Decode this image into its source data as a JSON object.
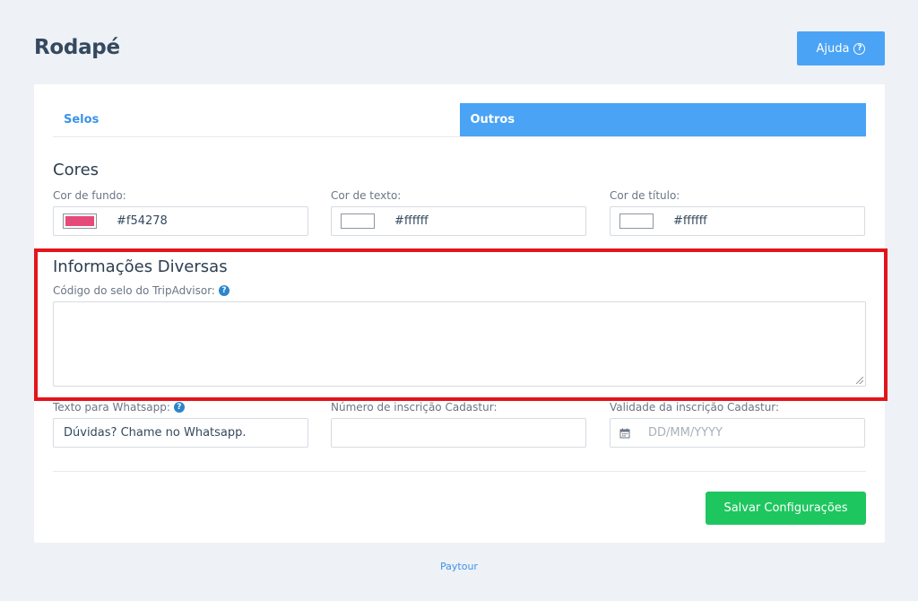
{
  "header": {
    "title": "Rodapé",
    "help_label": "Ajuda",
    "help_icon_glyph": "?"
  },
  "tabs": [
    {
      "label": "Selos",
      "active": false
    },
    {
      "label": "Outros",
      "active": true
    }
  ],
  "colors_section": {
    "title": "Cores",
    "fields": [
      {
        "label": "Cor de fundo:",
        "value": "#f54278",
        "swatch": "#e64a79"
      },
      {
        "label": "Cor de texto:",
        "value": "#ffffff",
        "swatch": "#ffffff"
      },
      {
        "label": "Cor de título:",
        "value": "#ffffff",
        "swatch": "#ffffff"
      }
    ]
  },
  "info_section": {
    "title": "Informações Diversas",
    "tripadvisor_label": "Código do selo do TripAdvisor:",
    "help_glyph": "?"
  },
  "extra_fields": {
    "whatsapp_label": "Texto para Whatsapp:",
    "whatsapp_value": "Dúvidas? Chame no Whatsapp.",
    "cadastur_number_label": "Número de inscrição Cadastur:",
    "cadastur_validity_label": "Validade da inscrição Cadastur:",
    "cadastur_validity_placeholder": "DD/MM/YYYY"
  },
  "actions": {
    "save_label": "Salvar Configurações"
  },
  "footer": {
    "link": "Paytour"
  },
  "theme": {
    "primary": "#4aa3f5",
    "success": "#1ec65f",
    "highlight": "#e3151a"
  }
}
